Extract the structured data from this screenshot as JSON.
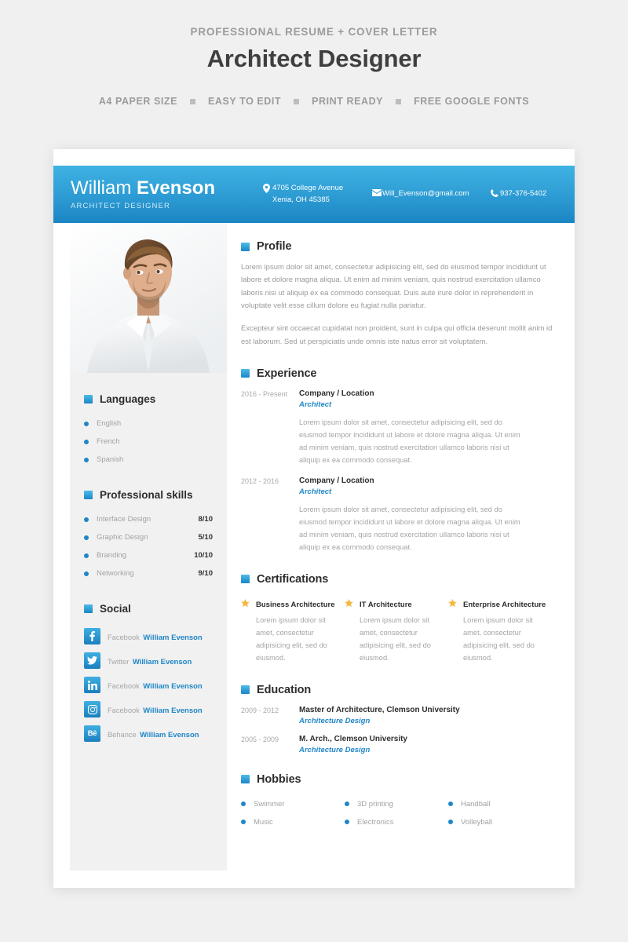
{
  "promo": {
    "eyebrow": "PROFESSIONAL RESUME + COVER LETTER",
    "title": "Architect Designer",
    "features": [
      "A4 PAPER SIZE",
      "EASY TO EDIT",
      "PRINT READY",
      "FREE GOOGLE FONTS"
    ]
  },
  "resume": {
    "header": {
      "first_name": "William",
      "last_name": "Evenson",
      "role": "ARCHITECT DESIGNER",
      "contacts": [
        {
          "icon": "location-pin-icon",
          "line1": "4705 College Avenue",
          "line2": "Xenia, OH 45385"
        },
        {
          "icon": "envelope-icon",
          "line1": "Will_Evenson@gmail.com",
          "line2": ""
        },
        {
          "icon": "phone-icon",
          "line1": "937-376-5402",
          "line2": ""
        }
      ]
    },
    "sidebar": {
      "languages": {
        "title": "Languages",
        "items": [
          "English",
          "French",
          "Spanish"
        ]
      },
      "skills": {
        "title": "Professional skills",
        "items": [
          {
            "label": "Interface Design",
            "value": "8/10"
          },
          {
            "label": "Graphic Design",
            "value": "5/10"
          },
          {
            "label": "Branding",
            "value": "10/10"
          },
          {
            "label": "Networking",
            "value": "9/10"
          }
        ]
      },
      "social": {
        "title": "Social",
        "items": [
          {
            "icon": "facebook-icon",
            "network": "Facebook",
            "username": "William Evenson"
          },
          {
            "icon": "twitter-icon",
            "network": "Twitter",
            "username": "William Evenson"
          },
          {
            "icon": "linkedin-icon",
            "network": "Facebook",
            "username": "William Evenson"
          },
          {
            "icon": "instagram-icon",
            "network": "Facebook",
            "username": "William Evenson"
          },
          {
            "icon": "behance-icon",
            "network": "Behance",
            "username": "William Evenson"
          }
        ]
      }
    },
    "main": {
      "profile": {
        "title": "Profile",
        "paragraphs": [
          "Lorem ipsum dolor sit amet, consectetur adipisicing elit, sed do eiusmod tempor incididunt ut labore et dolore magna aliqua. Ut enim ad minim veniam, quis nostrud exercitation ullamco laboris nisi ut aliquip ex ea commodo consequat. Duis aute irure dolor in reprehenderit in voluptate velit esse cillum dolore eu fugiat nulla pariatur.",
          "Excepteur sint occaecat cupidatat non proident, sunt in culpa qui officia deserunt mollit anim id est laborum. Sed ut perspiciatis unde omnis iste natus error sit voluptatem."
        ]
      },
      "experience": {
        "title": "Experience",
        "entries": [
          {
            "date": "2016 - Present",
            "title": "Company / Location",
            "subtitle": "Architect",
            "desc": "Lorem ipsum dolor sit amet, consectetur adipisicing elit, sed do eiusmod tempor incididunt ut labore et dolore magna aliqua. Ut enim ad minim veniam, quis nostrud exercitation ullamco laboris nisi ut aliquip ex ea commodo consequat."
          },
          {
            "date": "2012 - 2016",
            "title": "Company / Location",
            "subtitle": "Architect",
            "desc": "Lorem ipsum dolor sit amet, consectetur adipisicing elit, sed do eiusmod tempor incididunt ut labore et dolore magna aliqua. Ut enim ad minim veniam, quis nostrud exercitation ullamco laboris nisi ut aliquip ex ea commodo consequat."
          }
        ]
      },
      "certifications": {
        "title": "Certifications",
        "items": [
          {
            "icon": "star-icon",
            "title": "Business Architecture",
            "desc": "Lorem ipsum dolor sit amet, consectetur adipisicing elit, sed do eiusmod."
          },
          {
            "icon": "star-icon",
            "title": "IT Architecture",
            "desc": "Lorem ipsum dolor sit amet, consectetur adipisicing elit, sed do eiusmod."
          },
          {
            "icon": "star-icon",
            "title": "Enterprise Architecture",
            "desc": "Lorem ipsum dolor sit amet, consectetur adipisicing elit, sed do eiusmod."
          }
        ]
      },
      "education": {
        "title": "Education",
        "entries": [
          {
            "date": "2009 - 2012",
            "title": "Master of Architecture, Clemson University",
            "subtitle": "Architecture Design"
          },
          {
            "date": "2005 - 2009",
            "title": "M. Arch., Clemson University",
            "subtitle": "Architecture Design"
          }
        ]
      },
      "hobbies": {
        "title": "Hobbies",
        "items": [
          "Swimmer",
          "3D printing",
          "Handball",
          "Music",
          "Electronics",
          "Volleyball"
        ]
      }
    }
  },
  "colors": {
    "page_background": "#f0f0f0",
    "accent_blue": "#1f86c7",
    "header_gradient_top": "#3fb2e3",
    "header_gradient_bottom": "#1b85c4",
    "star_gold": "#f5b63c",
    "muted_text": "#a2a2a2"
  }
}
